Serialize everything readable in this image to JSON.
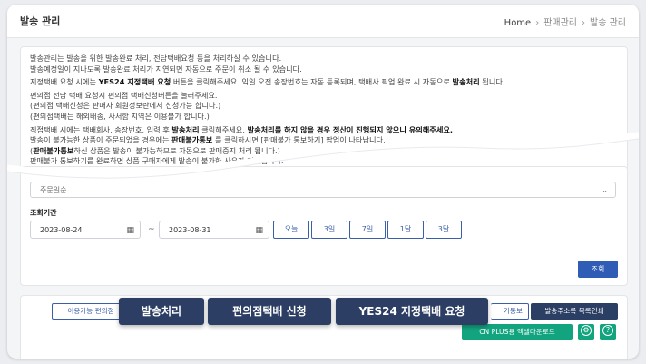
{
  "header": {
    "title": "발송 관리",
    "breadcrumb": [
      "Home",
      "판매관리",
      "발송 관리"
    ]
  },
  "info": {
    "lines_top": [
      "발송관리는 발송을 위한 발송완료 처리, 전담택배요청 등을 처리하실 수 있습니다.",
      "발송예정일이 지나도록 발송완료 처리가 지연되면 자동으로 주문이 취소 될 수 있습니다."
    ],
    "yes24": {
      "pre": "지정택배 요청 시에는 ",
      "b1": "YES24 지정택배 요청",
      "mid": " 버튼을 클릭해주세요. 익일 오전 송장번호는 자동 등록되며, 택배사 픽업 완료 시 자동으로 ",
      "b2": "발송처리",
      "post": " 됩니다."
    },
    "lines_conv": [
      "편의점 전담 택배 요청시 편의점 택배신청버튼을 눌러주세요.",
      "(편의점 택배신청은 판매자 회원정보란에서 신청가능 합니다.)",
      "(편의점택배는 해외배송, 사서함 지역은 이용불가 합니다.)"
    ],
    "direct": {
      "pre": "직접택배 시에는 택배회사, 송장번호, 입력 후 ",
      "b1": "발송처리",
      "mid": " 클릭해주세요. ",
      "b2": "발송처리를 하지 않을 경우 정산이 진행되지 않으니 유의해주세요."
    },
    "unavail": {
      "pre": "발송이 불가능한 상품이 주문되었을 경우에는 ",
      "b1": "판매불가통보",
      "post": " 를 클릭하시면 [판매불가 통보하기] 팝업이 나타납니다."
    },
    "notice": {
      "pre": "(",
      "b1": "판매불가통보",
      "post": "하신 상품은 발송이 불가능하므로 자동으로 판매중지 처리 됩니다.)"
    },
    "cutoff": "판매불가 통보하기를 완료하면 상품 구매자에게 발송이 불가한 사유가 전달됩니다."
  },
  "filter": {
    "select_value": "주문일순",
    "date_label": "조회기간",
    "start_date": "2023-08-24",
    "end_date": "2023-08-31",
    "range_separator": "~",
    "periods": [
      "오늘",
      "3일",
      "7일",
      "1달",
      "3달"
    ],
    "search_label": "조회"
  },
  "actions": {
    "available_label": "이용가능 편의점",
    "unavailable_label": "가통보",
    "print_label": "발송주소록 목록인쇄",
    "excel_label": "CN PLUS용 엑셀다운로드",
    "settings_glyph": "⚙",
    "help_glyph": "?"
  },
  "overlay": {
    "ship": "발송처리",
    "conv": "편의점택배 신청",
    "yes24": "YES24 지정택배 요청"
  },
  "colors": {
    "primary": "#2f5db5",
    "dark": "#2a3f63",
    "green": "#12a37f"
  }
}
